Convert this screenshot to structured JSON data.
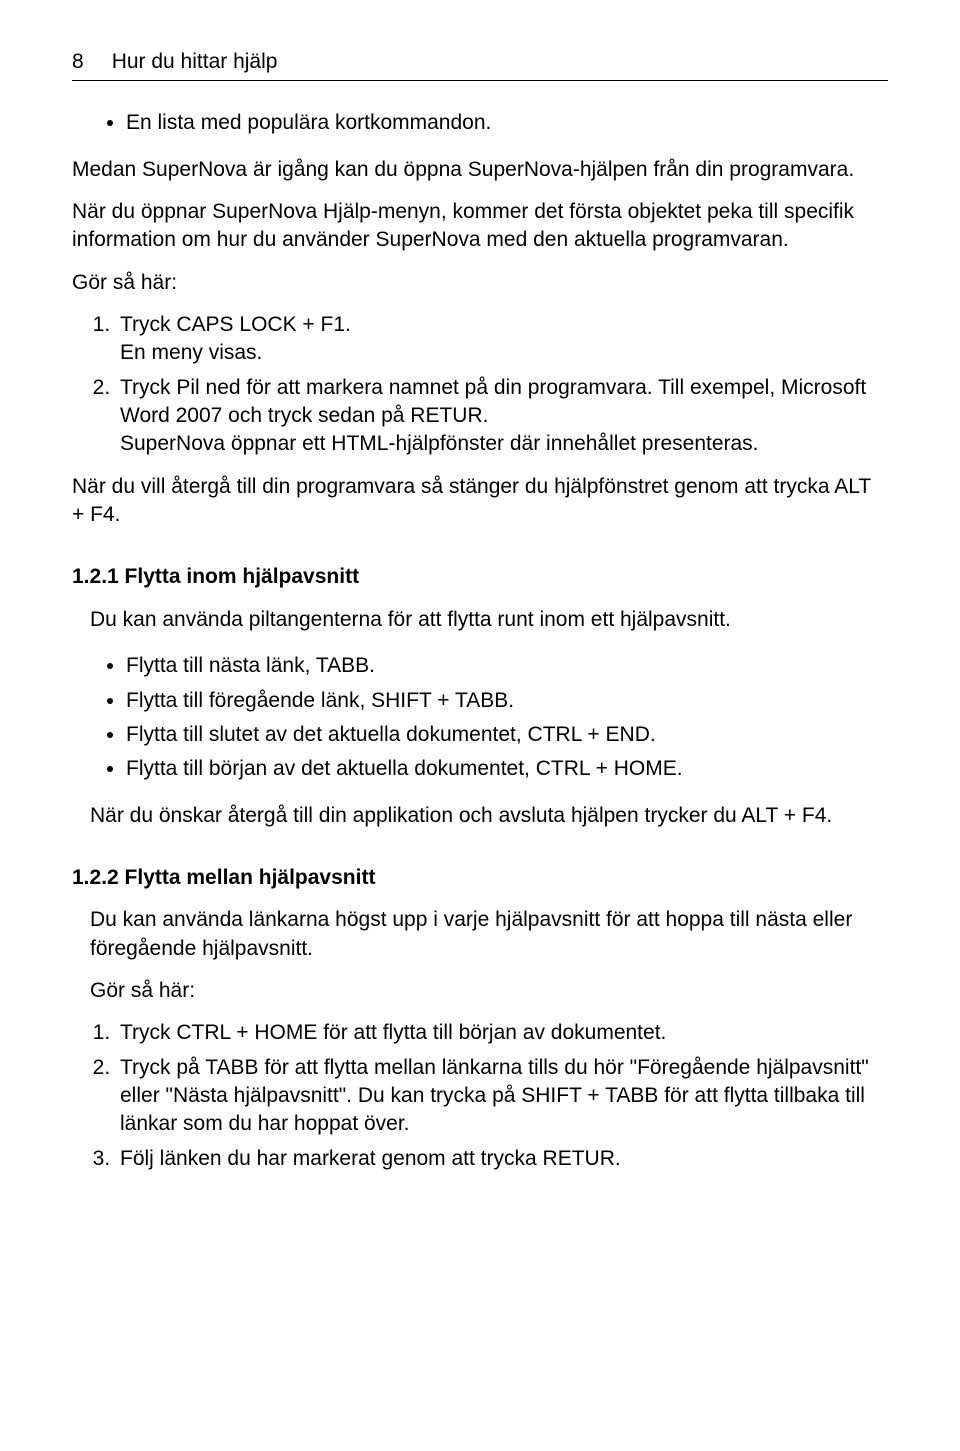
{
  "header": {
    "page_number": "8",
    "title": "Hur du hittar hjälp"
  },
  "intro_bullet": "En lista med populära kortkommandon.",
  "para1": "Medan SuperNova är igång kan du öppna SuperNova-hjälpen från din programvara.",
  "para2": "När du öppnar SuperNova Hjälp-menyn, kommer det första objektet peka till specifik information om hur du använder SuperNova med den aktuella programvaran.",
  "do_this": "Gör så här:",
  "steps1": {
    "s1a": "Tryck CAPS LOCK + F1.",
    "s1b": "En meny visas.",
    "s2a": "Tryck Pil ned för att markera namnet på din programvara. Till exempel, Microsoft Word 2007 och tryck sedan på RETUR.",
    "s2b": "SuperNova öppnar ett HTML-hjälpfönster där innehållet presenteras."
  },
  "para_after_steps1": "När du vill återgå till din programvara så stänger du hjälpfönstret genom att trycka ALT + F4.",
  "section_121": {
    "title": "1.2.1  Flytta inom hjälpavsnitt",
    "intro": "Du kan använda piltangenterna för att flytta runt inom ett hjälpavsnitt.",
    "bullets": [
      "Flytta till nästa länk, TABB.",
      "Flytta till föregående länk, SHIFT + TABB.",
      "Flytta till slutet av det aktuella dokumentet, CTRL + END.",
      "Flytta till början av det aktuella dokumentet, CTRL + HOME."
    ],
    "after": "När du önskar återgå till din applikation och avsluta hjälpen trycker du ALT + F4."
  },
  "section_122": {
    "title": "1.2.2  Flytta mellan hjälpavsnitt",
    "intro": "Du kan använda länkarna högst upp i varje hjälpavsnitt för att hoppa till nästa eller föregående hjälpavsnitt.",
    "do_this": "Gör så här:",
    "steps": [
      "Tryck CTRL + HOME för att flytta till början av dokumentet.",
      "Tryck på TABB för att flytta mellan länkarna tills du hör \"Föregående hjälpavsnitt\" eller \"Nästa hjälpavsnitt\". Du kan trycka på SHIFT + TABB för att flytta tillbaka till länkar som du har hoppat över.",
      "Följ länken du har markerat genom att trycka RETUR."
    ]
  }
}
